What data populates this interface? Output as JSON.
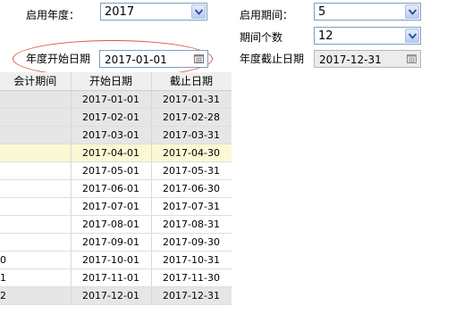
{
  "form": {
    "start_year_label": "启用年度：",
    "start_year_value": "2017",
    "start_period_label": "启用期间：",
    "start_period_value": "5",
    "period_count_label": "期间个数",
    "period_count_value": "12",
    "year_start_date_label": "年度开始日期",
    "year_start_date_value": "2017-01-01",
    "year_end_date_label": "年度截止日期",
    "year_end_date_value": "2017-12-31"
  },
  "table": {
    "headers": [
      "会计期间",
      "开始日期",
      "截止日期"
    ],
    "rows": [
      {
        "period": "",
        "start": "2017-01-01",
        "end": "2017-01-31"
      },
      {
        "period": "",
        "start": "2017-02-01",
        "end": "2017-02-28"
      },
      {
        "period": "",
        "start": "2017-03-01",
        "end": "2017-03-31"
      },
      {
        "period": "",
        "start": "2017-04-01",
        "end": "2017-04-30"
      },
      {
        "period": "",
        "start": "2017-05-01",
        "end": "2017-05-31"
      },
      {
        "period": "",
        "start": "2017-06-01",
        "end": "2017-06-30"
      },
      {
        "period": "",
        "start": "2017-07-01",
        "end": "2017-07-31"
      },
      {
        "period": "",
        "start": "2017-08-01",
        "end": "2017-08-31"
      },
      {
        "period": "",
        "start": "2017-09-01",
        "end": "2017-09-30"
      },
      {
        "period": "0",
        "start": "2017-10-01",
        "end": "2017-10-31"
      },
      {
        "period": "1",
        "start": "2017-11-01",
        "end": "2017-11-30"
      },
      {
        "period": "2",
        "start": "2017-12-01",
        "end": "2017-12-31"
      }
    ]
  }
}
